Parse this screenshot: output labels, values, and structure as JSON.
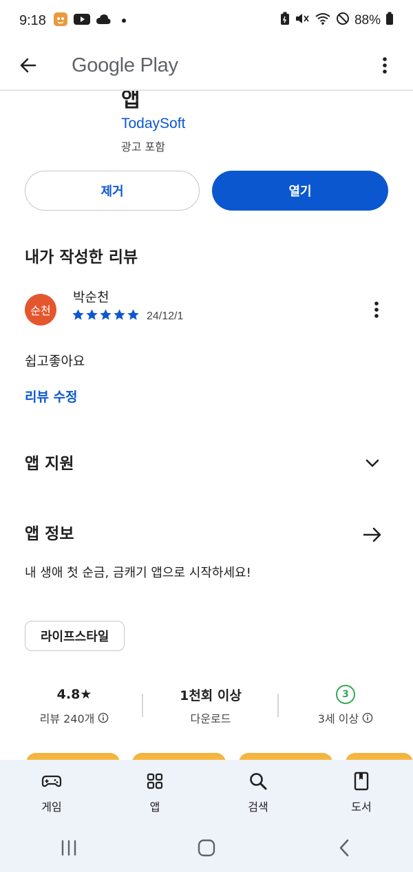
{
  "status_bar": {
    "time": "9:18",
    "battery": "88%"
  },
  "app_bar": {
    "title": "Google Play"
  },
  "app": {
    "title_fragment": "앱",
    "developer": "TodaySoft",
    "ads_note": "광고 포함",
    "remove_label": "제거",
    "open_label": "열기"
  },
  "my_review": {
    "header": "내가 작성한 리뷰",
    "avatar_text": "순천",
    "avatar_color": "#e4572e",
    "reviewer": "박순천",
    "rating": 5,
    "date": "24/12/1",
    "text": "쉽고좋아요",
    "edit_label": "리뷰 수정"
  },
  "app_support": {
    "label": "앱 지원"
  },
  "app_info": {
    "label": "앱 정보",
    "description": "내 생애 첫 순금, 금캐기 앱으로 시작하세요!",
    "category": "라이프스타일"
  },
  "stats": {
    "rating": "4.8★",
    "reviews": "리뷰 240개",
    "downloads": "1천회 이상",
    "downloads_label": "다운로드",
    "age_badge": "3",
    "age_label": "3세 이상"
  },
  "bottom_nav": [
    {
      "label": "게임",
      "icon": "gamepad-icon"
    },
    {
      "label": "앱",
      "icon": "apps-grid-icon"
    },
    {
      "label": "검색",
      "icon": "search-icon"
    },
    {
      "label": "도서",
      "icon": "book-icon"
    }
  ],
  "colors": {
    "accent": "#0b57d0",
    "nav_bg": "#eef2f9",
    "star": "#0b57d0"
  }
}
